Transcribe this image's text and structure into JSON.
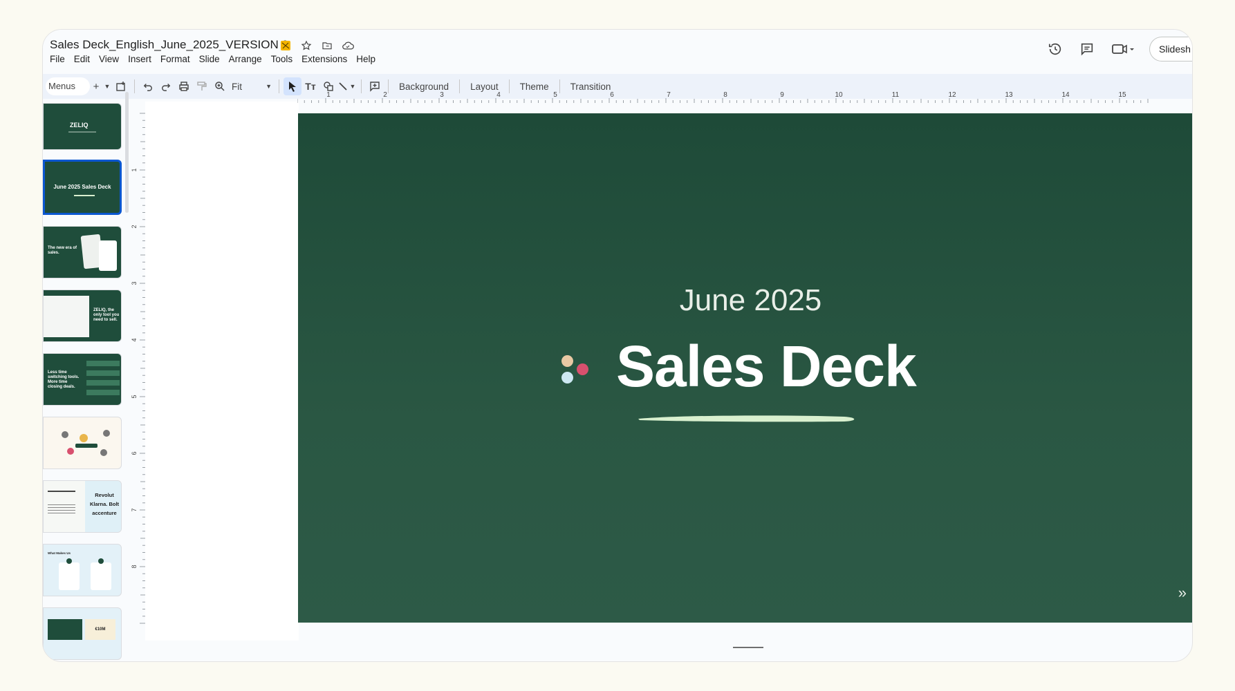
{
  "document": {
    "title": "Sales Deck_English_June_2025_VERSION 2"
  },
  "menu": [
    "File",
    "Edit",
    "View",
    "Insert",
    "Format",
    "Slide",
    "Arrange",
    "Tools",
    "Extensions",
    "Help"
  ],
  "header_right": {
    "slideshow_label": "Slidesh"
  },
  "toolbar": {
    "menus_label": "Menus",
    "zoom_value": "Fit",
    "background_label": "Background",
    "layout_label": "Layout",
    "theme_label": "Theme",
    "transition_label": "Transition"
  },
  "ruler": {
    "horizontal": [
      "1",
      "2",
      "3",
      "4",
      "5",
      "6",
      "7",
      "8",
      "9",
      "10",
      "11",
      "12",
      "13",
      "14",
      "15"
    ],
    "vertical": [
      "1",
      "2",
      "3",
      "4",
      "5",
      "6",
      "7",
      "8"
    ]
  },
  "filmstrip": {
    "thumbs": [
      {
        "text": "ZELIQ"
      },
      {
        "text": "June 2025 Sales Deck"
      },
      {
        "text": "The new era of sales."
      },
      {
        "text": "ZELIQ, the only tool you need to sell."
      },
      {
        "text": "Less time switching tools. More time closing deals."
      },
      {
        "text": ""
      },
      {
        "text": "Revolut Klarna. Bolt accenture"
      },
      {
        "text": "What Makes Us"
      },
      {
        "text": "€10M"
      }
    ]
  },
  "slide": {
    "date": "June 2025",
    "title": "Sales Deck",
    "colors": {
      "background_top": "#1e4a38",
      "background_bottom": "#2d5a47",
      "dot_peach": "#e9c9a4",
      "dot_pink": "#d8506e",
      "dot_blue": "#cde8f2",
      "swoosh": "#d9f0cf"
    }
  }
}
